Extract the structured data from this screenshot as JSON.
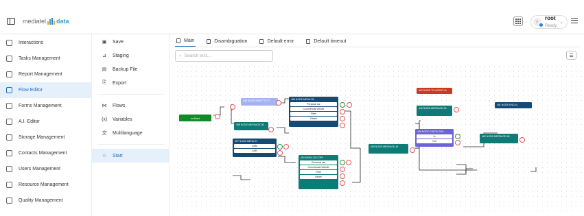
{
  "header": {
    "logo_primary": "mediatel",
    "logo_secondary": "data",
    "user_initial": "r",
    "user_name": "root",
    "user_status": "Ready",
    "status_color": "#2f7de1"
  },
  "sidebar": {
    "items": [
      {
        "label": "Interactions",
        "icon": "phone-icon"
      },
      {
        "label": "Tasks Management",
        "icon": "clipboard-icon"
      },
      {
        "label": "Report Management",
        "icon": "chart-icon"
      },
      {
        "label": "Flow Editor",
        "icon": "flow-icon",
        "active": true
      },
      {
        "label": "Forms Management",
        "icon": "form-icon"
      },
      {
        "label": "A.I. Editor",
        "icon": "robot-icon"
      },
      {
        "label": "Storage Management",
        "icon": "storage-icon"
      },
      {
        "label": "Contacts Management",
        "icon": "contacts-icon"
      },
      {
        "label": "Users Management",
        "icon": "users-icon"
      },
      {
        "label": "Resource Management",
        "icon": "resource-icon"
      },
      {
        "label": "Quality Management",
        "icon": "star-icon"
      }
    ]
  },
  "tools": {
    "save": "Save",
    "staging": "Staging",
    "backup_file": "Backup File",
    "export": "Export",
    "flows": "Flows",
    "variables": "Variables",
    "multilanguage": "Multilanguage",
    "start": "Start"
  },
  "tabs": [
    "Main",
    "Disambiguation",
    "Default error",
    "Default timeout"
  ],
  "search": {
    "placeholder": "Search text..."
  },
  "flow": {
    "start_node": "onStart",
    "nodes": {
      "n455": {
        "title": "455 NODE-MENU-38",
        "rows": [
          "Personal car",
          "Commercial Vehicle",
          "Fleet",
          "Diesel"
        ]
      },
      "n456": {
        "title": "456 NODE-MESSAGE-36"
      },
      "n457": {
        "title": "457 NODE-MENU-37",
        "rows": [
          "ASM",
          "ASR"
        ]
      },
      "n458": {
        "title": "458 NODE-SMARTTEXT"
      },
      "n452": {
        "title": "452 MENU-35-COPY",
        "rows": [
          "Personal car",
          "Commercial Vehicle",
          "Fleet",
          "Diesel"
        ]
      },
      "n450": {
        "title": "450 NODE-MESSAGE-44"
      },
      "n462": {
        "title": "462 NODE-TO-AGENT-41"
      },
      "n442": {
        "title": "442 NODE-MESSAGE-43"
      },
      "n436": {
        "title": "436 NODE-CHECK-PAS...",
        "rows": [
          "In",
          "Out"
        ]
      },
      "n461": {
        "title": "461 NODE-END-41"
      },
      "n462b": {
        "title": "462 NODE-MESSAGE-48"
      }
    }
  },
  "colors": {
    "accent": "#1b6dbf",
    "teal": "#0f7b76",
    "green": "#128a28",
    "red": "#c93a1e",
    "navy": "#154a75",
    "purple": "#6b63d6"
  }
}
